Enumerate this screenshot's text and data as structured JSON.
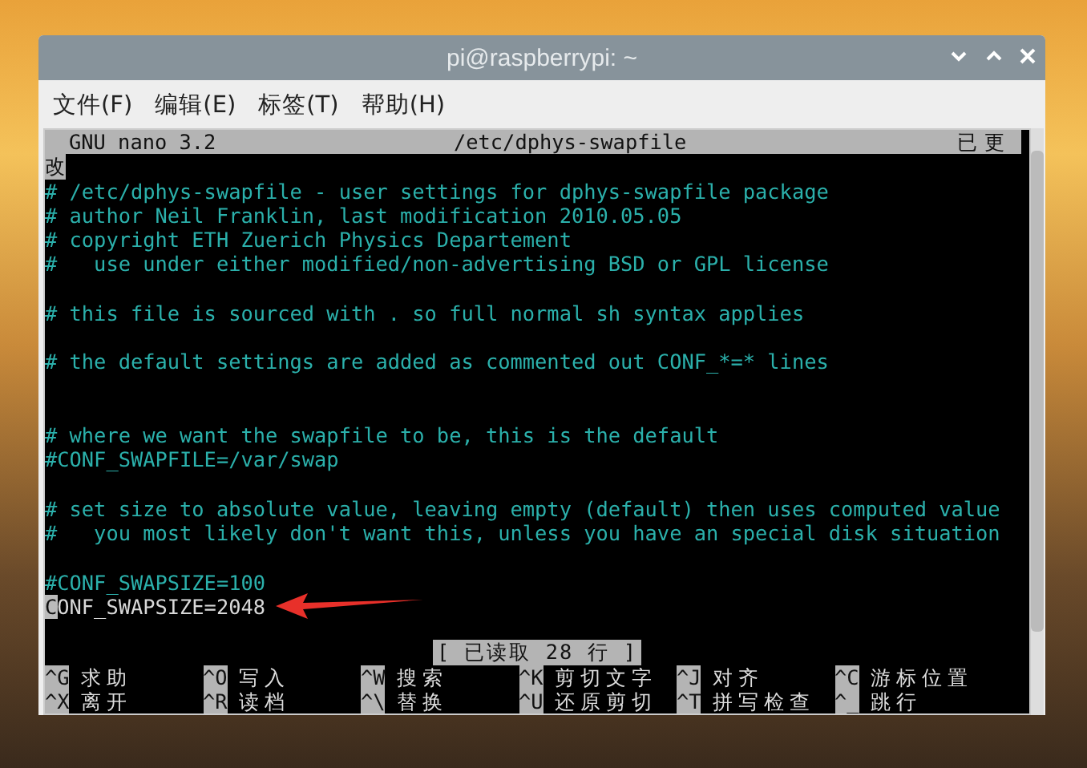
{
  "window": {
    "title": "pi@raspberrypi: ~"
  },
  "menu": [
    "文件(F)",
    "编辑(E)",
    "标签(T)",
    "帮助(H)"
  ],
  "nano": {
    "header": {
      "app": "GNU nano 3.2",
      "file": "/etc/dphys-swapfile",
      "status": "已更",
      "status_wrap": "改"
    },
    "lines": [
      {
        "kind": "comment",
        "text": "# /etc/dphys-swapfile - user settings for dphys-swapfile package"
      },
      {
        "kind": "comment",
        "text": "# author Neil Franklin, last modification 2010.05.05"
      },
      {
        "kind": "comment",
        "text": "# copyright ETH Zuerich Physics Departement"
      },
      {
        "kind": "comment",
        "text": "#   use under either modified/non-advertising BSD or GPL license"
      },
      {
        "kind": "blank"
      },
      {
        "kind": "comment",
        "text": "# this file is sourced with . so full normal sh syntax applies"
      },
      {
        "kind": "blank"
      },
      {
        "kind": "comment",
        "text": "# the default settings are added as commented out CONF_*=* lines"
      },
      {
        "kind": "blank"
      },
      {
        "kind": "blank"
      },
      {
        "kind": "comment",
        "text": "# where we want the swapfile to be, this is the default"
      },
      {
        "kind": "comment",
        "text": "#CONF_SWAPFILE=/var/swap"
      },
      {
        "kind": "blank"
      },
      {
        "kind": "comment",
        "text": "# set size to absolute value, leaving empty (default) then uses computed value"
      },
      {
        "kind": "comment",
        "text": "#   you most likely don't want this, unless you have an special disk situation"
      },
      {
        "kind": "blank"
      },
      {
        "kind": "comment",
        "text": "#CONF_SWAPSIZE=100"
      },
      {
        "kind": "plain",
        "cursor": "C",
        "text": "ONF_SWAPSIZE=2048",
        "annotated": true
      }
    ],
    "status": "[ 已读取 28 行 ]",
    "shortcuts": [
      [
        {
          "key": "^G",
          "label": "求助"
        },
        {
          "key": "^O",
          "label": "写入"
        },
        {
          "key": "^W",
          "label": "搜索"
        },
        {
          "key": "^K",
          "label": "剪切文字"
        },
        {
          "key": "^J",
          "label": "对齐"
        },
        {
          "key": "^C",
          "label": "游标位置"
        }
      ],
      [
        {
          "key": "^X",
          "label": "离开"
        },
        {
          "key": "^R",
          "label": "读档"
        },
        {
          "key": "^\\",
          "label": "替换"
        },
        {
          "key": "^U",
          "label": "还原剪切"
        },
        {
          "key": "^T",
          "label": "拼写检查"
        },
        {
          "key": "^_",
          "label": "跳行"
        }
      ]
    ]
  }
}
